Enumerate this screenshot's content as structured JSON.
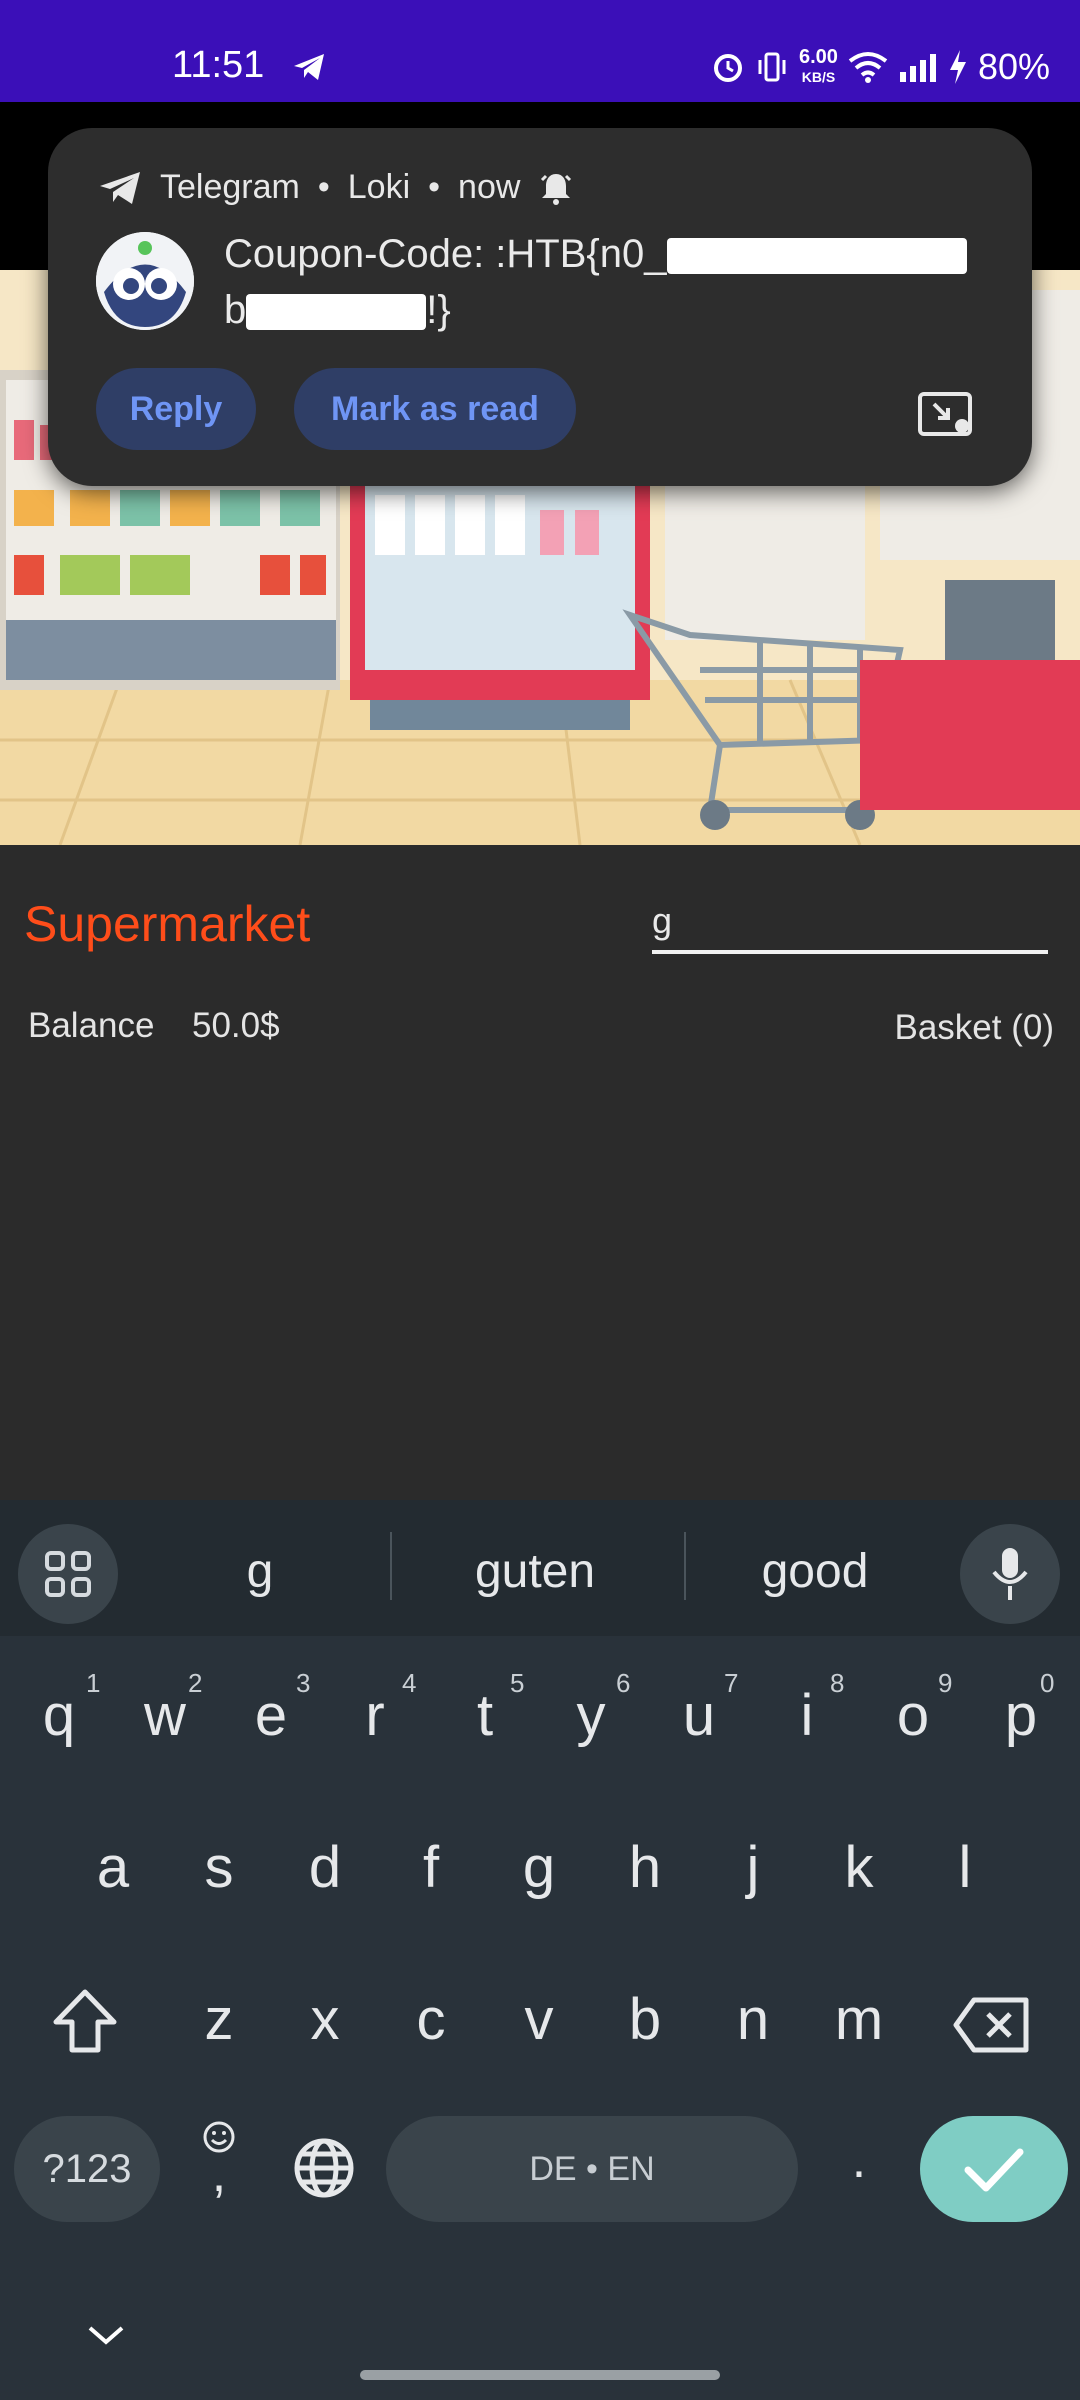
{
  "status_bar": {
    "time": "11:51",
    "speed_value": "6.00",
    "speed_unit": "KB/S",
    "battery": "80%",
    "icons": [
      "telegram-icon",
      "alarm-icon",
      "vibrate-icon",
      "wifi-icon",
      "signal-icon",
      "charging-icon"
    ]
  },
  "notification": {
    "app": "Telegram",
    "sender": "Loki",
    "time": "now",
    "line1_prefix": "Coupon-Code: :HTB{n0_",
    "line2_prefix": "b",
    "line2_suffix": "!}",
    "reply_label": "Reply",
    "mark_read_label": "Mark as read"
  },
  "store": {
    "title": "Supermarket",
    "search_value": "g",
    "balance_label": "Balance",
    "balance_value": "50.0$",
    "basket_label": "Basket (0)"
  },
  "keyboard": {
    "suggestions": [
      "g",
      "guten",
      "good"
    ],
    "row1": [
      "q",
      "w",
      "e",
      "r",
      "t",
      "y",
      "u",
      "i",
      "o",
      "p"
    ],
    "row1_nums": [
      "1",
      "2",
      "3",
      "4",
      "5",
      "6",
      "7",
      "8",
      "9",
      "0"
    ],
    "row2": [
      "a",
      "s",
      "d",
      "f",
      "g",
      "h",
      "j",
      "k",
      "l"
    ],
    "row3": [
      "z",
      "x",
      "c",
      "v",
      "b",
      "n",
      "m"
    ],
    "symbols_label": "?123",
    "comma": ",",
    "period": ".",
    "space_label": "DE • EN"
  },
  "colors": {
    "status_bar": "#3b0fb8",
    "title_accent": "#ff4d1a",
    "notification_button_text": "#6f95f5",
    "enter_key": "#7fcdc4"
  }
}
